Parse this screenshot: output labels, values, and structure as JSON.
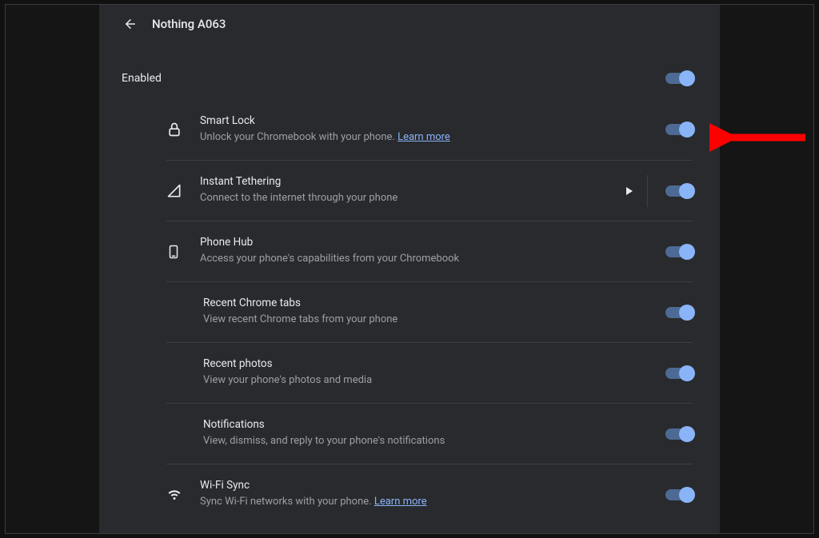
{
  "header": {
    "title": "Nothing A063"
  },
  "enabled_label": "Enabled",
  "learn_more": "Learn more",
  "items": {
    "smart_lock": {
      "title": "Smart Lock",
      "desc": "Unlock your Chromebook with your phone."
    },
    "tethering": {
      "title": "Instant Tethering",
      "desc": "Connect to the internet through your phone"
    },
    "phone_hub": {
      "title": "Phone Hub",
      "desc": "Access your phone's capabilities from your Chromebook"
    },
    "recent_tabs": {
      "title": "Recent Chrome tabs",
      "desc": "View recent Chrome tabs from your phone"
    },
    "recent_photos": {
      "title": "Recent photos",
      "desc": "View your phone's photos and media"
    },
    "notifications": {
      "title": "Notifications",
      "desc": "View, dismiss, and reply to your phone's notifications"
    },
    "wifi_sync": {
      "title": "Wi-Fi Sync",
      "desc": "Sync Wi-Fi networks with your phone."
    }
  },
  "toggles": {
    "enabled": true,
    "smart_lock": true,
    "tethering": true,
    "phone_hub": true,
    "recent_tabs": true,
    "recent_photos": true,
    "notifications": true,
    "wifi_sync": true
  }
}
